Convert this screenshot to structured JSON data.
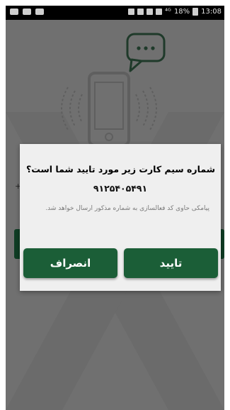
{
  "status_bar": {
    "signal_text": "⁴ᴳ",
    "battery_percent": "18%",
    "time": "13:08"
  },
  "dialog": {
    "title": "شماره سیم کارت زیر مورد تایید شما است؟",
    "phone_number": "۹۱۲۵۴۰۵۴۹۱",
    "message": "پیامکی حاوی کد فعالسازی به شماره مذکور ارسال خواهد شد.",
    "cancel_label": "انصراف",
    "confirm_label": "تایید"
  },
  "background": {
    "plus_glyph": "+"
  },
  "colors": {
    "button": "#1b5e37",
    "overlay": "#707070",
    "dialog_bg": "#efefef"
  }
}
